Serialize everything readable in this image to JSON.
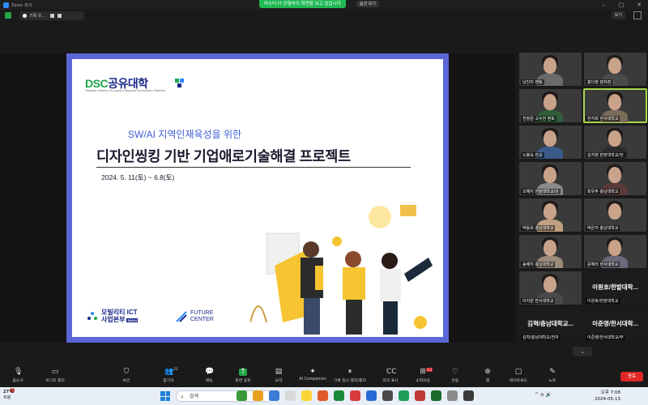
{
  "window": {
    "app_title": "Zoom 회의",
    "share_banner": "마스터 IT 강형숙의 화면을 보고 있습니다",
    "view_button": "옵션 보기",
    "view_top_label": "보기"
  },
  "recording": {
    "label": "기록 유..."
  },
  "slide": {
    "logo_dsc": "DSC",
    "logo_kr": "공유대학",
    "logo_sub": "Daejeon Sejong Chungnam Regional Innovation Platform",
    "subtitle": "SW/AI 지역인재육성을 위한",
    "title": "디자인씽킹 기반 기업애로기술해결 프로젝트",
    "date": "2024. 5. 11(토) ~ 6.8(토)",
    "mobility_line1": "모빌리티 ICT",
    "mobility_line2": "사업본부",
    "mobility_badge": "SW/AI",
    "future_line1": "FUTURE",
    "future_line2": "CENTER"
  },
  "participants": [
    {
      "name": "남진미 멘토",
      "type": "video",
      "shirt": "#6b6b6b"
    },
    {
      "name": "홍다영 잠자점",
      "type": "video",
      "shirt": "#4a4a4a"
    },
    {
      "name": "천정원 고수천 멘토",
      "type": "video",
      "shirt": "#2f5d3a"
    },
    {
      "name": "한지희 한서대학교",
      "type": "video",
      "shirt": "#7a6a5a",
      "active": true
    },
    {
      "name": "노봉숙 한교",
      "type": "video",
      "shirt": "#3a5a8a"
    },
    {
      "name": "김지현 한밭대학교/전",
      "type": "video",
      "shirt": "#2a2a2a"
    },
    {
      "name": "오혜지 한밭대학교/산",
      "type": "video",
      "shirt": "#8a8a8a"
    },
    {
      "name": "최유주 충남대학교",
      "type": "video",
      "shirt": "#5a3a3a"
    },
    {
      "name": "박동희 충남대학교",
      "type": "video",
      "shirt": "#c0a080"
    },
    {
      "name": "박은지 충남대학교",
      "type": "video",
      "shirt": "#3a3a3a"
    },
    {
      "name": "송예지 충남대학교",
      "type": "video",
      "shirt": "#9a8a7a"
    },
    {
      "name": "윤혜리 한서대학교",
      "type": "video",
      "shirt": "#6a6a7a"
    },
    {
      "name": "이지원 한서대학교",
      "type": "video",
      "shirt": "#4a4a4a"
    },
    {
      "name": "이원호/한밭대학...",
      "type": "text",
      "full": "이원호/한밭대학교"
    },
    {
      "name": "김혁/충남대학교...",
      "type": "text",
      "full": "김혁/충남대학교/전자"
    },
    {
      "name": "이준영/한서대학...",
      "type": "text",
      "full": "이준영/한서대학교/무"
    }
  ],
  "toolbar": {
    "items": [
      {
        "label": "음소거",
        "icon": "mic-icon",
        "glyph": "🎙"
      },
      {
        "label": "비디오 중지",
        "icon": "video-icon",
        "glyph": "▭"
      },
      {
        "label": "보안",
        "icon": "shield-icon",
        "glyph": "⛉"
      },
      {
        "label": "참가자",
        "icon": "participants-icon",
        "glyph": "👥",
        "count": "22"
      },
      {
        "label": "채팅",
        "icon": "chat-icon",
        "glyph": "💬"
      },
      {
        "label": "화면 공유",
        "icon": "share-screen-icon",
        "glyph": "↑"
      },
      {
        "label": "요약",
        "icon": "summary-icon",
        "glyph": "▤"
      },
      {
        "label": "AI Companion",
        "icon": "ai-companion-icon",
        "glyph": "✦"
      },
      {
        "label": "기록 일시 중지/중지",
        "icon": "record-icon",
        "glyph": "⏸"
      },
      {
        "label": "자막 표시",
        "icon": "captions-icon",
        "glyph": "CC"
      },
      {
        "label": "소회의실",
        "icon": "breakout-icon",
        "glyph": "⊞",
        "badge": "1:1"
      },
      {
        "label": "반응",
        "icon": "reactions-icon",
        "glyph": "♡"
      },
      {
        "label": "앱",
        "icon": "apps-icon",
        "glyph": "⊕"
      },
      {
        "label": "화이트보드",
        "icon": "whiteboard-icon",
        "glyph": "▢"
      },
      {
        "label": "노트",
        "icon": "notes-icon",
        "glyph": "✎"
      }
    ],
    "end_label": "종료"
  },
  "taskbar": {
    "temp": "27°C",
    "weather": "흐림",
    "notif_count": "1",
    "search_placeholder": "검색",
    "time": "오후 7:08",
    "date": "2024-05-13",
    "tray_text": "^ ≋ 🔊"
  },
  "colors": {
    "share_green": "#23a74b",
    "slide_frame": "#5b67d6",
    "end_red": "#e02828"
  }
}
